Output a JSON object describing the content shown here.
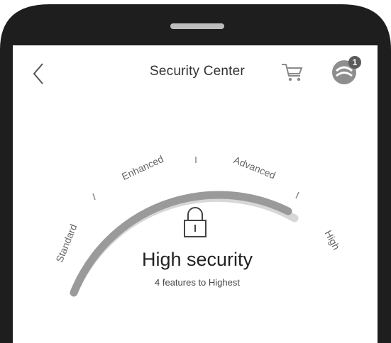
{
  "header": {
    "title": "Security Center",
    "back_icon": "chevron-left-icon",
    "cart_icon": "cart-icon",
    "avatar_icon": "avatar-icon",
    "notification_count": "1"
  },
  "gauge": {
    "levels": [
      "Standard",
      "Enhanced",
      "Advanced",
      "High"
    ],
    "progress_fraction": 0.75,
    "progress_color": "#9a9a9a",
    "track_color": "#d7d7d7"
  },
  "status": {
    "lock_icon": "lock-icon",
    "headline": "High security",
    "subline": "4 features to Highest"
  },
  "colors": {
    "frame": "#1e1e1e",
    "text": "#333333"
  }
}
